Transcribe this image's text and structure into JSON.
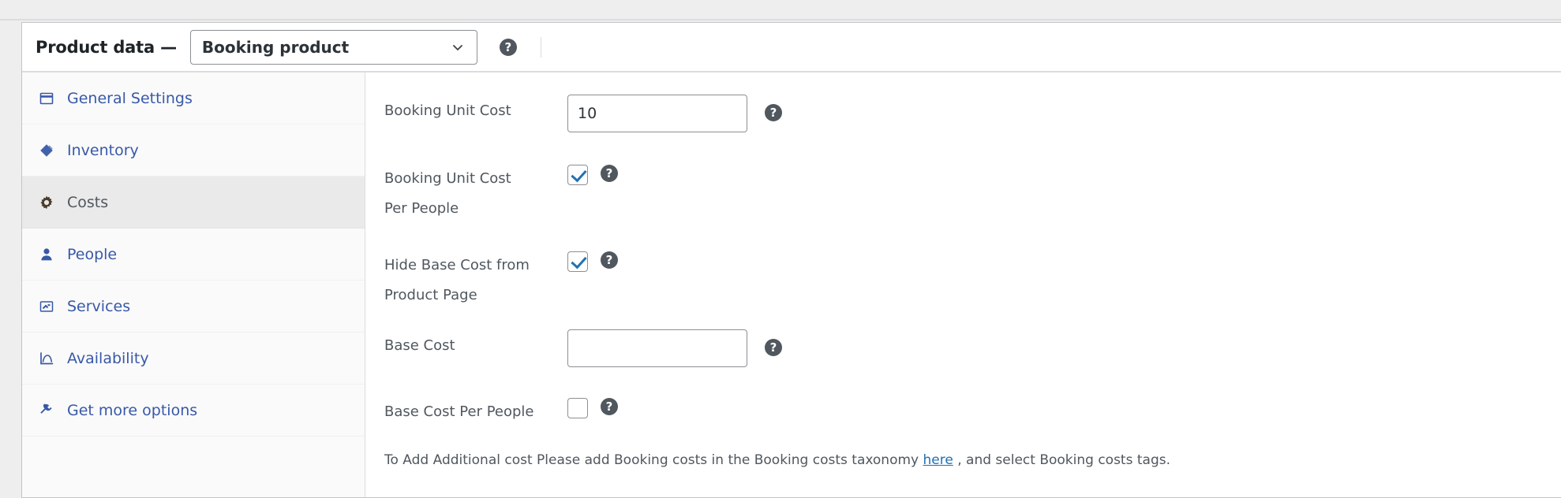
{
  "header": {
    "title": "Product data —",
    "product_type": {
      "selected": "Booking product",
      "options": [
        "Booking product"
      ]
    },
    "help_tooltip": "?"
  },
  "sidebar": {
    "items": [
      {
        "label": "General Settings",
        "icon": "window-icon",
        "active": false
      },
      {
        "label": "Inventory",
        "icon": "tag-icon",
        "active": false
      },
      {
        "label": "Costs",
        "icon": "gear-icon",
        "active": true
      },
      {
        "label": "People",
        "icon": "person-icon",
        "active": false
      },
      {
        "label": "Services",
        "icon": "card-icon",
        "active": false
      },
      {
        "label": "Availability",
        "icon": "chart-icon",
        "active": false
      },
      {
        "label": "Get more options",
        "icon": "plug-icon",
        "active": false
      }
    ]
  },
  "fields": {
    "booking_unit_cost": {
      "label": "Booking Unit Cost",
      "value": "10",
      "placeholder": "",
      "help": "?"
    },
    "booking_unit_cost_per_people": {
      "label_line1": "Booking Unit Cost",
      "label_line2": "Per People",
      "checked": true,
      "help": "?"
    },
    "hide_base_cost": {
      "label_line1": "Hide Base Cost from",
      "label_line2": "Product Page",
      "checked": true,
      "help": "?"
    },
    "base_cost": {
      "label": "Base Cost",
      "value": "",
      "placeholder": "",
      "help": "?"
    },
    "base_cost_per_people": {
      "label": "Base Cost Per People",
      "checked": false,
      "help": "?"
    }
  },
  "note": {
    "before": "To Add Additional cost Please add Booking costs in the Booking costs taxonomy ",
    "link": "here",
    "after": " , and select Booking costs tags."
  },
  "colors": {
    "link": "#2271b1",
    "nav_link": "#3858a8",
    "text": "#50575e",
    "panel_bg": "#ffffff",
    "sidebar_bg": "#fafafa",
    "active_tab_bg": "#eaeaea",
    "page_bg": "#eeeeee"
  }
}
